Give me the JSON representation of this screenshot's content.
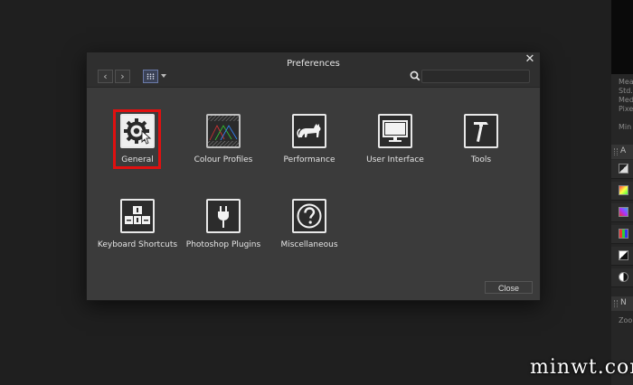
{
  "dialog": {
    "title": "Preferences",
    "close_icon": "close-icon",
    "toolbar": {
      "back_icon": "chevron-left-icon",
      "forward_icon": "chevron-right-icon",
      "view_icon": "grid-view-icon",
      "search_icon": "search-icon",
      "search_placeholder": ""
    },
    "items": [
      {
        "label": "General",
        "icon": "gear-icon",
        "selected": true
      },
      {
        "label": "Colour Profiles",
        "icon": "colour-profiles-icon"
      },
      {
        "label": "Performance",
        "icon": "cat-icon"
      },
      {
        "label": "User Interface",
        "icon": "monitor-icon"
      },
      {
        "label": "Tools",
        "icon": "hammer-icon"
      },
      {
        "label": "Keyboard Shortcuts",
        "icon": "keyboard-icon"
      },
      {
        "label": "Photoshop Plugins",
        "icon": "plug-icon"
      },
      {
        "label": "Miscellaneous",
        "icon": "question-icon"
      }
    ],
    "close_label": "Close"
  },
  "right_panel": {
    "lines": [
      "Mea",
      "Std.",
      "Med",
      "Pixe"
    ],
    "min_label": "Min",
    "header_a": "A",
    "header_n": "N",
    "zoom_label": "Zoon"
  },
  "watermark": "minwt.com",
  "colors": {
    "highlight": "#e01010",
    "dialog_bg": "#3b3b3b",
    "titlebar_bg": "#2f2f2f"
  }
}
